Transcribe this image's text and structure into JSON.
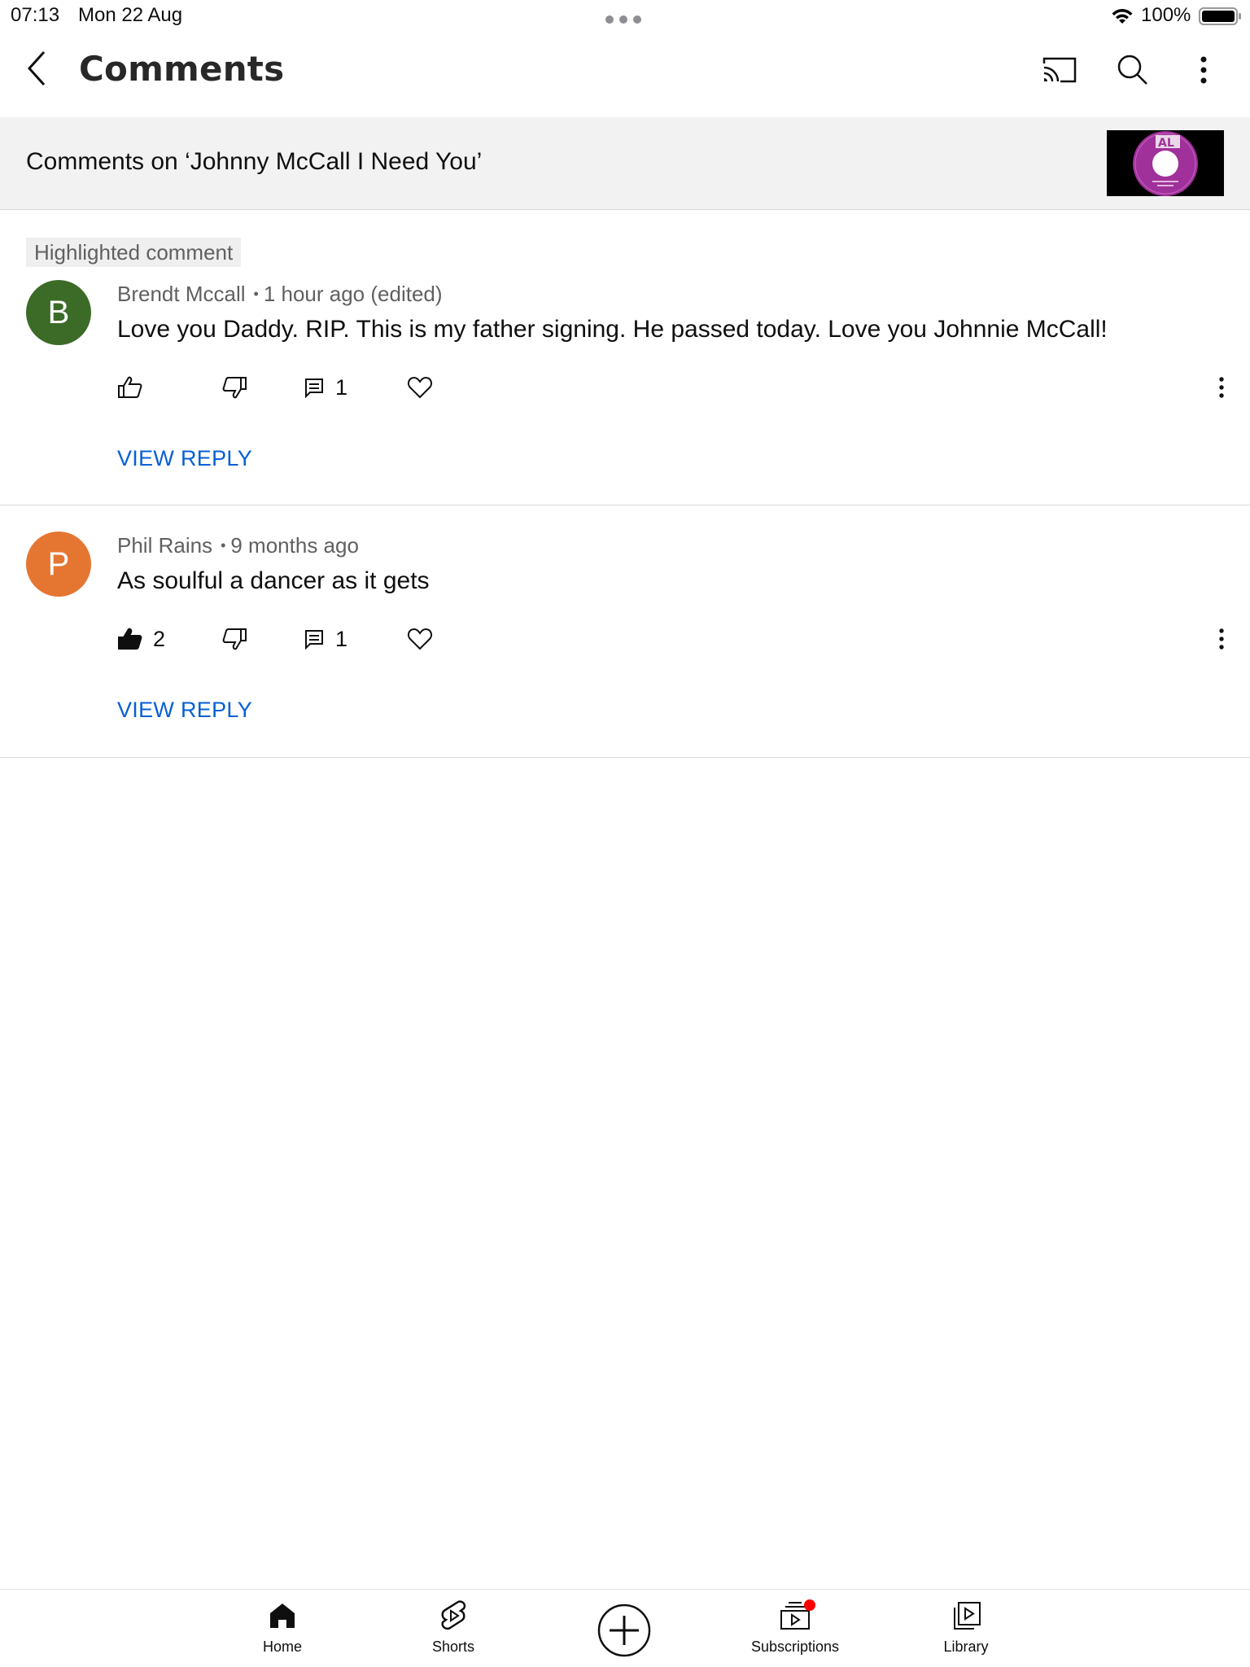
{
  "status_bar": {
    "time": "07:13",
    "date": "Mon 22 Aug",
    "battery": "100%"
  },
  "header": {
    "title": "Comments",
    "icons": [
      "back-icon",
      "cast-icon",
      "search-icon",
      "more-vertical-icon"
    ]
  },
  "video": {
    "comments_on": "Comments on ‘Johnny McCall I Need You’",
    "thumbnail_logo": "AL"
  },
  "comments": [
    {
      "badge": "Highlighted comment",
      "avatar_letter": "B",
      "avatar_color": "#3c6b28",
      "author": "Brendt Mccall",
      "separator": "•",
      "time": "1 hour ago (edited)",
      "text": "Love you Daddy. RIP. This is my father signing. He passed today. Love you Johnnie McCall!",
      "likes": "",
      "liked": false,
      "replies": "1",
      "view_reply": "VIEW REPLY"
    },
    {
      "avatar_letter": "P",
      "avatar_color": "#e57631",
      "author": "Phil Rains",
      "separator": "•",
      "time": "9 months ago",
      "text": "As soulful a dancer as it gets",
      "likes": "2",
      "liked": true,
      "replies": "1",
      "view_reply": "VIEW REPLY"
    }
  ],
  "bottom_nav": {
    "items": [
      {
        "label": "Home",
        "icon": "home-icon"
      },
      {
        "label": "Shorts",
        "icon": "shorts-icon"
      },
      {
        "label": "",
        "icon": "create-plus-icon"
      },
      {
        "label": "Subscriptions",
        "icon": "subscriptions-icon"
      },
      {
        "label": "Library",
        "icon": "library-icon"
      }
    ]
  },
  "colors": {
    "link_blue": "#065fd4",
    "header_bg": "#f2f2f2",
    "notification_dot": "#ff0000"
  }
}
